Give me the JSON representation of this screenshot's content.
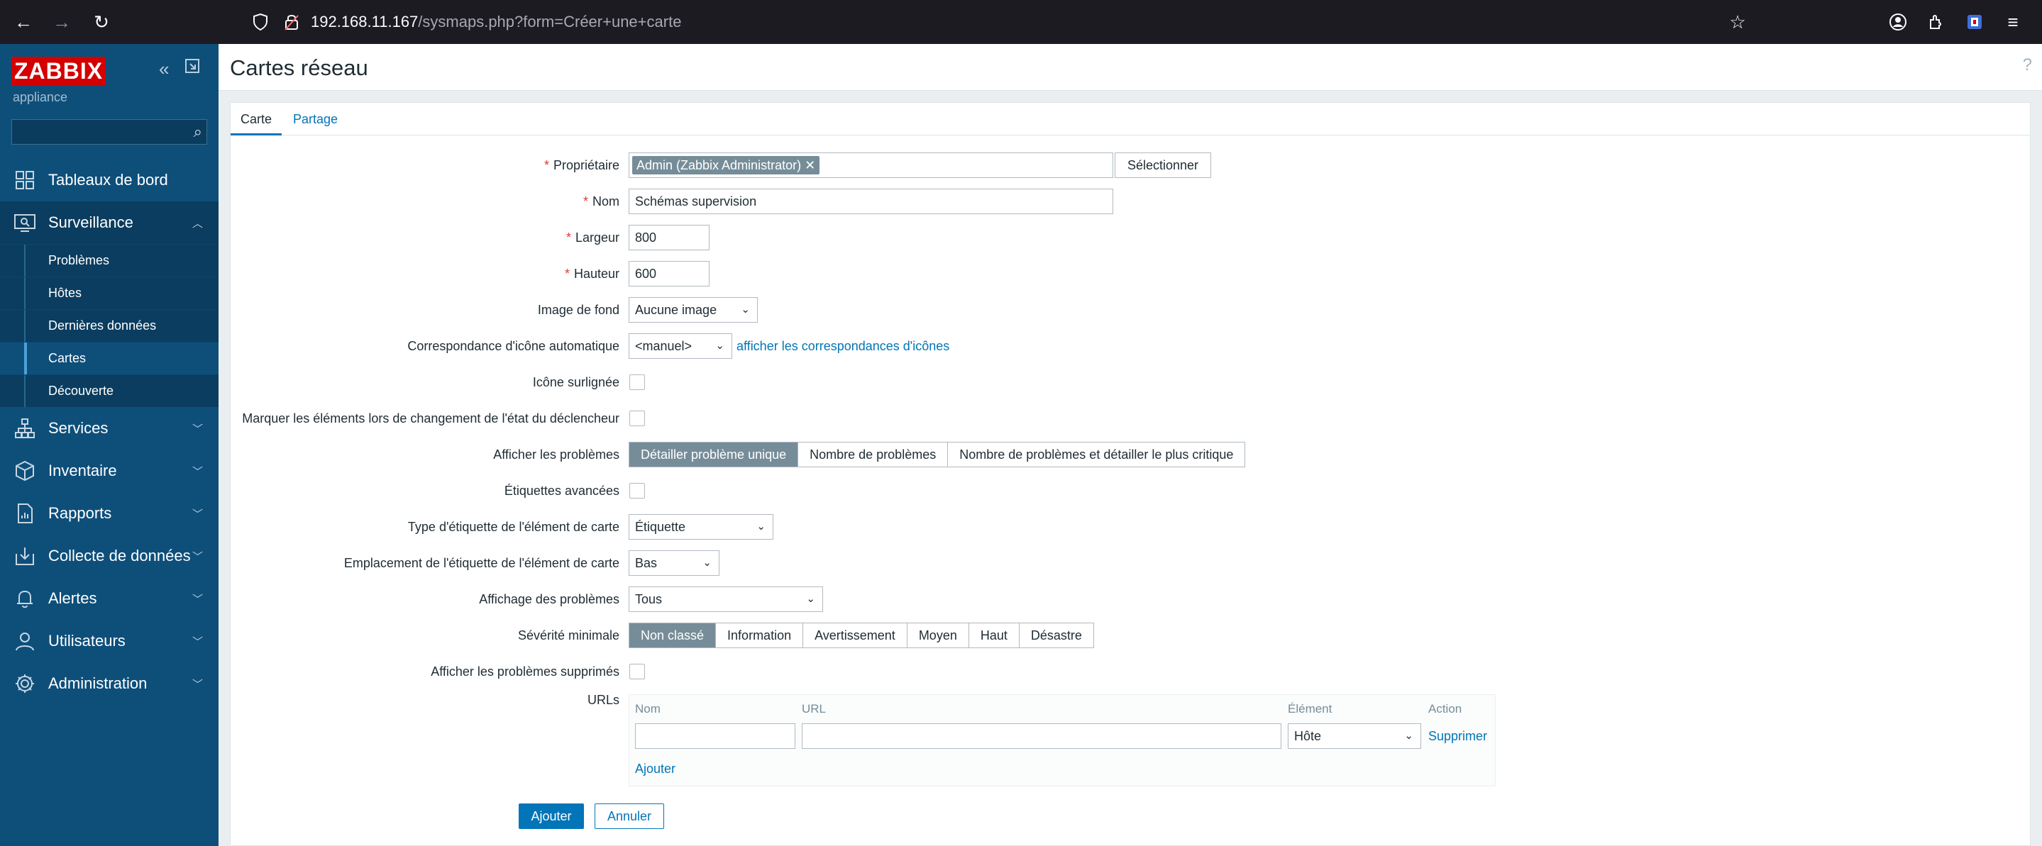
{
  "browser": {
    "url_host": "192.168.11.167",
    "url_path": "/sysmaps.php?form=Créer+une+carte"
  },
  "sidebar": {
    "logo": "ZABBIX",
    "server_name": "appliance",
    "search_placeholder": "",
    "menu": {
      "dashboards": "Tableaux de bord",
      "monitoring": "Surveillance",
      "services": "Services",
      "inventory": "Inventaire",
      "reports": "Rapports",
      "data_collection": "Collecte de données",
      "alerts": "Alertes",
      "users": "Utilisateurs",
      "administration": "Administration"
    },
    "monitoring_sub": {
      "problems": "Problèmes",
      "hosts": "Hôtes",
      "latest_data": "Dernières données",
      "maps": "Cartes",
      "discovery": "Découverte"
    }
  },
  "page": {
    "title": "Cartes réseau",
    "help": "?"
  },
  "tabs": {
    "map": "Carte",
    "sharing": "Partage"
  },
  "form": {
    "owner": {
      "label": "Propriétaire",
      "value": "Admin (Zabbix Administrator)",
      "select_button": "Sélectionner"
    },
    "name": {
      "label": "Nom",
      "value": "Schémas supervision"
    },
    "width": {
      "label": "Largeur",
      "value": "800"
    },
    "height": {
      "label": "Hauteur",
      "value": "600"
    },
    "background": {
      "label": "Image de fond",
      "value": "Aucune image"
    },
    "icon_mapping": {
      "label": "Correspondance d'icône automatique",
      "value": "<manuel>",
      "link": "afficher les correspondances d'icônes"
    },
    "highlight": {
      "label": "Icône surlignée"
    },
    "mark_elements": {
      "label": "Marquer les éléments lors de changement de l'état du déclencheur"
    },
    "show_problems": {
      "label": "Afficher les problèmes",
      "options": [
        "Détailler problème unique",
        "Nombre de problèmes",
        "Nombre de problèmes et détailler le plus critique"
      ],
      "selected": 0
    },
    "advanced_labels": {
      "label": "Étiquettes avancées"
    },
    "label_type": {
      "label": "Type d'étiquette de l'élément de carte",
      "value": "Étiquette"
    },
    "label_location": {
      "label": "Emplacement de l'étiquette de l'élément de carte",
      "value": "Bas"
    },
    "problem_display": {
      "label": "Affichage des problèmes",
      "value": "Tous"
    },
    "min_severity": {
      "label": "Sévérité minimale",
      "options": [
        "Non classé",
        "Information",
        "Avertissement",
        "Moyen",
        "Haut",
        "Désastre"
      ],
      "selected": 0
    },
    "show_suppressed": {
      "label": "Afficher les problèmes supprimés"
    },
    "urls": {
      "label": "URLs",
      "col_name": "Nom",
      "col_url": "URL",
      "col_element": "Élément",
      "col_action": "Action",
      "row_name": "",
      "row_url": "",
      "row_element": "Hôte",
      "remove": "Supprimer",
      "add": "Ajouter"
    },
    "submit": "Ajouter",
    "cancel": "Annuler"
  }
}
